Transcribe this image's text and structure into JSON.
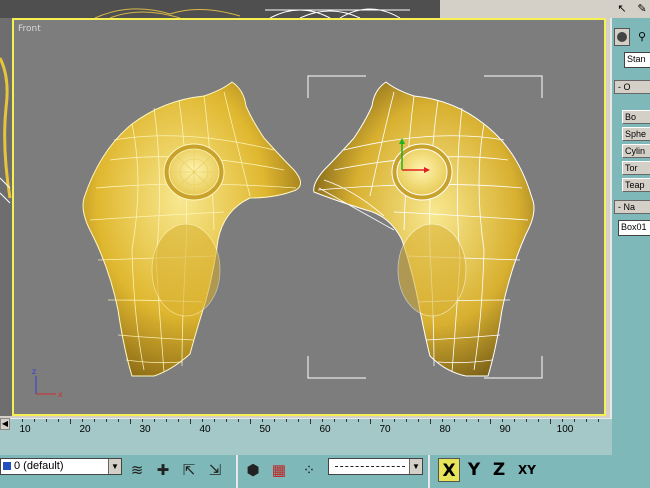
{
  "viewport": {
    "label": "Front"
  },
  "command_panel": {
    "object_type_dropdown": "Stan",
    "rollout_object_type": "- O",
    "object_buttons": [
      "Bo",
      "Sphe",
      "Cylin",
      "Tor",
      "Teap"
    ],
    "rollout_name": "- Na",
    "name_field": "Box01"
  },
  "ruler": {
    "ticks": [
      10,
      20,
      30,
      40,
      50,
      60,
      70,
      80,
      90,
      100
    ]
  },
  "bottom_toolbar": {
    "layer_value": "0 (default)",
    "axis_x": "X",
    "axis_y": "Y",
    "axis_z": "Z",
    "axis_xy": "XY"
  },
  "colors": {
    "viewport_bg": "#7d7d7d",
    "active_border": "#f6f055",
    "mesh_yellow": "#e8c43a",
    "panel_teal": "#7fb8b8"
  }
}
